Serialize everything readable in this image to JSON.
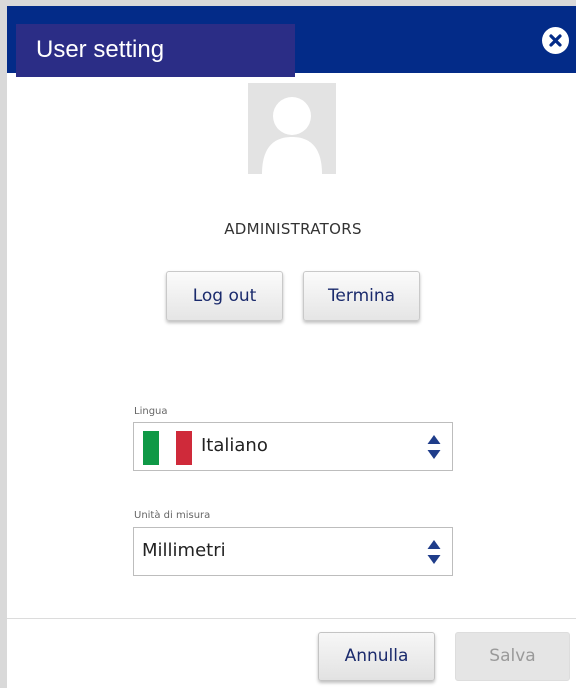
{
  "header": {
    "title": "User setting",
    "close_icon": "close-icon"
  },
  "user": {
    "avatar_icon": "user-avatar-icon",
    "role": "ADMINISTRATORS"
  },
  "actions": {
    "logout_label": "Log out",
    "termina_label": "Termina"
  },
  "language": {
    "label": "Lingua",
    "value": "Italiano",
    "flag_icon": "italy-flag-icon"
  },
  "units": {
    "label": "Unità di misura",
    "value": "Millimetri"
  },
  "footer": {
    "cancel_label": "Annulla",
    "save_label": "Salva"
  },
  "colors": {
    "header": "#032b88",
    "title_box": "#2b2d86",
    "button_text": "#1a2a6c",
    "flag_green": "#0f9946",
    "flag_red": "#cf2a3a"
  }
}
